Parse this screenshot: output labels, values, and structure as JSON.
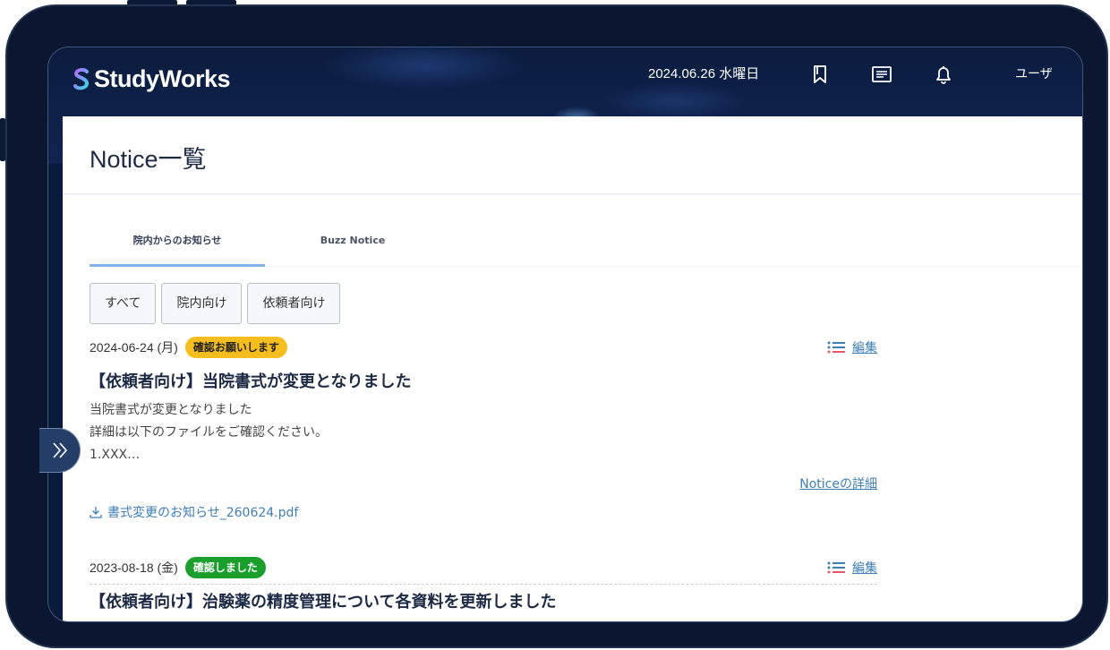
{
  "app": {
    "logo_text": "StudyWorks"
  },
  "header": {
    "date": "2024.06.26 水曜日",
    "icons": [
      "bookmark-icon",
      "message-icon",
      "bell-icon"
    ],
    "user": "ユーザ"
  },
  "page": {
    "title": "Notice一覧"
  },
  "tabs": [
    {
      "label": "院内からのお知らせ",
      "active": true
    },
    {
      "label": "Buzz Notice",
      "active": false
    }
  ],
  "filters": [
    "すべて",
    "院内向け",
    "依頼者向け"
  ],
  "notices": [
    {
      "date": "2024-06-24 (月)",
      "badge": "確認お願いします",
      "badge_color": "#f6bd1e",
      "edit_label": "編集",
      "title": "【依頼者向け】当院書式が変更となりました",
      "body_lines": [
        "当院書式が変更となりました",
        "詳細は以下のファイルをご確認ください。",
        "1.XXX…"
      ],
      "detail_link": "Noticeの詳細",
      "attachment": "書式変更のお知らせ_260624.pdf"
    },
    {
      "date": "2023-08-18 (金)",
      "badge": "確認しました",
      "badge_color": "#1a9f2c",
      "edit_label": "編集",
      "title": "【依頼者向け】治験薬の精度管理について各資料を更新しました"
    }
  ]
}
